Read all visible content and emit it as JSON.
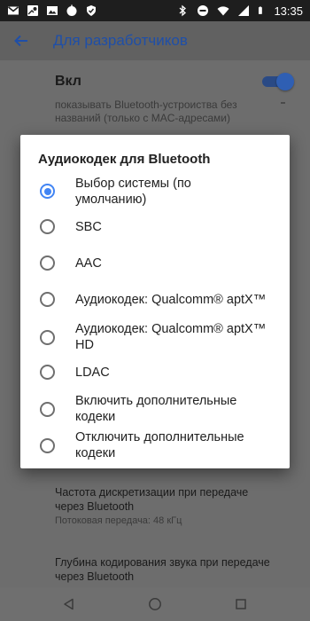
{
  "status_bar": {
    "time": "13:35",
    "left_icons": [
      "gmail-icon",
      "maps-icon",
      "image-icon",
      "circle-app-icon",
      "shield-check-icon"
    ],
    "right_icons": [
      "bluetooth-icon",
      "do-not-disturb-icon",
      "wifi-icon",
      "signal-icon",
      "battery-icon"
    ]
  },
  "app_bar": {
    "title": "Для разработчиков",
    "back_icon": "back-arrow-icon"
  },
  "background": {
    "main_switch_label": "Вкл",
    "bluetooth_devices_line1": "показывать Bluetooth-устроиства без",
    "bluetooth_devices_line2": "названий (только с MAC-адресами)",
    "sample_rate_title_line1": "Частота дискретизации при передаче",
    "sample_rate_title_line2": "через Bluetooth",
    "sample_rate_sub": "Потоковая передача: 48 кГц",
    "bit_depth_title_line1": "Глубина кодирования звука при передаче",
    "bit_depth_title_line2": "через Bluetooth"
  },
  "dialog": {
    "title": "Аудиокодек для Bluetooth",
    "options": [
      {
        "line1": "Выбор системы (по",
        "line2": "умолчанию)",
        "selected": true
      },
      {
        "line1": "SBC",
        "line2": "",
        "selected": false
      },
      {
        "line1": "AAC",
        "line2": "",
        "selected": false
      },
      {
        "line1": "Аудиокодек: Qualcomm® aptX™",
        "line2": "",
        "selected": false
      },
      {
        "line1": "Аудиокодек: Qualcomm® aptX™",
        "line2": "HD",
        "selected": false
      },
      {
        "line1": "LDAC",
        "line2": "",
        "selected": false
      },
      {
        "line1": "Включить дополнительные",
        "line2": "кодеки",
        "selected": false
      },
      {
        "line1": "Отключить дополнительные",
        "line2": "кодеки",
        "selected": false
      }
    ]
  },
  "nav_bar": {
    "buttons": [
      "nav-back-icon",
      "nav-home-icon",
      "nav-recents-icon"
    ]
  },
  "colors": {
    "accent": "#4285f4",
    "scrim_bg": "#6d6d6d",
    "app_bar": "#616161",
    "status_bar": "#1e1e1e"
  }
}
